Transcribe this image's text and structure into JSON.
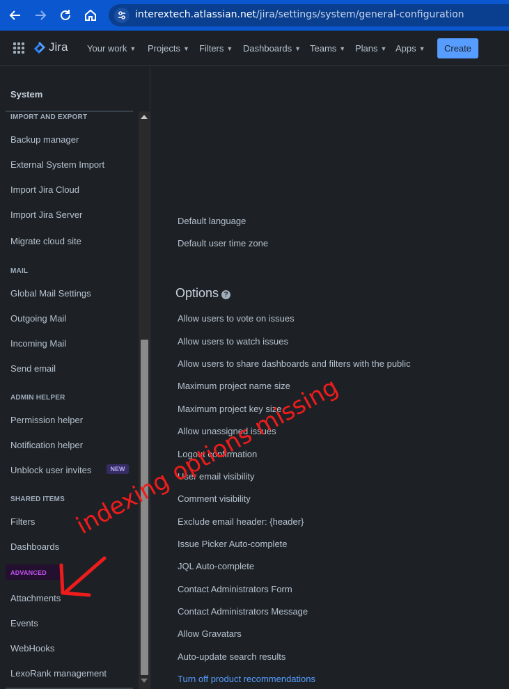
{
  "browser": {
    "url_host": "interextech.atlassian.net",
    "url_path": "/jira/settings/system/general-configuration",
    "icons": [
      "back-icon",
      "forward-icon",
      "reload-icon",
      "home-icon",
      "site-settings-icon"
    ]
  },
  "topnav": {
    "product": "Jira",
    "items": [
      {
        "label": "Your work"
      },
      {
        "label": "Projects"
      },
      {
        "label": "Filters"
      },
      {
        "label": "Dashboards"
      },
      {
        "label": "Teams"
      },
      {
        "label": "Plans"
      },
      {
        "label": "Apps"
      }
    ],
    "create_label": "Create"
  },
  "sidebar": {
    "title": "System",
    "sections": {
      "import_export": "IMPORT AND EXPORT",
      "mail": "MAIL",
      "admin_helper": "ADMIN HELPER",
      "shared_items": "SHARED ITEMS",
      "advanced": "ADVANCED"
    },
    "items": [
      "Backup manager",
      "External System Import",
      "Import Jira Cloud",
      "Import Jira Server",
      "Migrate cloud site",
      "Global Mail Settings",
      "Outgoing Mail",
      "Incoming Mail",
      "Send email",
      "Permission helper",
      "Notification helper",
      "Unblock user invites",
      "Filters",
      "Dashboards",
      "Attachments",
      "Events",
      "WebHooks",
      "LexoRank management"
    ],
    "new_badge": "NEW"
  },
  "main": {
    "internationalization_rows": [
      "Default language",
      "Default user time zone"
    ],
    "options_heading": "Options",
    "options": [
      "Allow users to vote on issues",
      "Allow users to watch issues",
      "Allow users to share dashboards and filters with the public",
      "Maximum project name size",
      "Maximum project key size",
      "Allow unassigned issues",
      "Logout confirmation",
      "User email visibility",
      "Comment visibility",
      "Exclude email header: {header}",
      "Issue Picker Auto-complete",
      "JQL Auto-complete",
      "Contact Administrators Form",
      "Contact Administrators Message",
      "Allow Gravatars",
      "Auto-update search results"
    ],
    "recommendations_link": "Turn off product recommendations"
  },
  "annotation": {
    "text": "indexing options missing",
    "color": "#ee1c1c"
  },
  "colors": {
    "background": "#1d2125",
    "text": "#b6c2cf",
    "link": "#579dff",
    "browser_bar": "#0b57d0",
    "create_button": "#579dff"
  }
}
